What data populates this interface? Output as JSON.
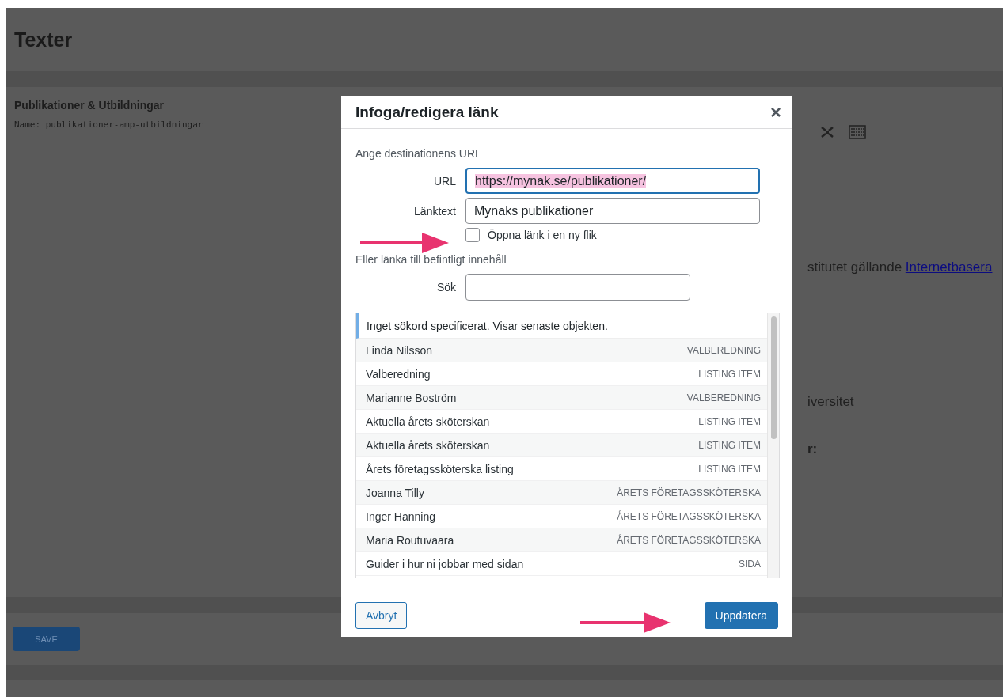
{
  "page": {
    "title": "Texter",
    "field_label": "Publikationer & Utbildningar",
    "field_name": "Name: publikationer-amp-utbildningar",
    "editor_text_1": "stitutet gällande",
    "editor_link": "Internetbasera",
    "editor_text_2": "iversitet",
    "editor_text_3": "r:",
    "save_button": "SAVE"
  },
  "dialog": {
    "title": "Infoga/redigera länk",
    "close": "×",
    "section_url": "Ange destinationens URL",
    "url": {
      "label": "URL",
      "value": "https://mynak.se/publikationer/",
      "focused": true,
      "text_selected": true
    },
    "link_text": {
      "label": "Länktext",
      "value": "Mynaks publikationer",
      "focused": false,
      "text_selected": false
    },
    "new_tab": {
      "label": "Öppna länk i en ny flik",
      "checked": false
    },
    "section_existing": "Eller länka till befintligt innehåll",
    "search": {
      "label": "Sök"
    },
    "notice": "Inget sökord specificerat. Visar senaste objekten.",
    "results": [
      {
        "title": "Linda Nilsson",
        "type": "VALBEREDNING",
        "selected": false
      },
      {
        "title": "Valberedning",
        "type": "LISTING ITEM",
        "selected": false
      },
      {
        "title": "Marianne Boström",
        "type": "VALBEREDNING",
        "selected": false
      },
      {
        "title": "Aktuella årets sköterskan",
        "type": "LISTING ITEM",
        "selected": false
      },
      {
        "title": "Aktuella årets sköterskan",
        "type": "LISTING ITEM",
        "selected": false
      },
      {
        "title": "Årets företagssköterska listing",
        "type": "LISTING ITEM",
        "selected": false
      },
      {
        "title": "Joanna Tilly",
        "type": "ÅRETS FÖRETAGSSKÖTERSKA",
        "selected": false
      },
      {
        "title": "Inger Hanning",
        "type": "ÅRETS FÖRETAGSSKÖTERSKA",
        "selected": false
      },
      {
        "title": "Maria Routuvaara",
        "type": "ÅRETS FÖRETAGSSKÖTERSKA",
        "selected": false
      },
      {
        "title": "Guider i hur ni jobbar med sidan",
        "type": "SIDA",
        "selected": false
      }
    ],
    "cancel_button": "Avbryt",
    "update_button": "Uppdatera"
  }
}
